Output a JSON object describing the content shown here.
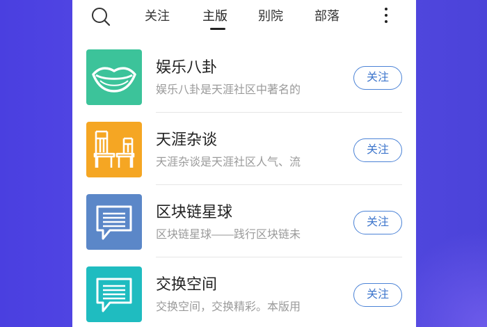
{
  "nav": {
    "tabs": [
      {
        "label": "关注",
        "active": false
      },
      {
        "label": "主版",
        "active": true
      },
      {
        "label": "别院",
        "active": false
      },
      {
        "label": "部落",
        "active": false
      }
    ],
    "search_icon": "search-icon",
    "more_icon": "more-vertical-icon"
  },
  "boards": [
    {
      "title": "娱乐八卦",
      "desc": "娱乐八卦是天涯社区中著名的",
      "icon": "lips-icon",
      "icon_color": "#3cc39a",
      "follow_label": "关注"
    },
    {
      "title": "天涯杂谈",
      "desc": "天涯杂谈是天涯社区人气、流",
      "icon": "chairs-icon",
      "icon_color": "#f5a623",
      "follow_label": "关注"
    },
    {
      "title": "区块链星球",
      "desc": "区块链星球——践行区块链未",
      "icon": "message-icon",
      "icon_color": "#5b87c8",
      "follow_label": "关注"
    },
    {
      "title": "交换空间",
      "desc": "交换空间，交换精彩。本版用",
      "icon": "message-icon",
      "icon_color": "#1fbcc0",
      "follow_label": "关注"
    }
  ],
  "colors": {
    "accent": "#4a82d6",
    "background": "#4a3fe0"
  }
}
